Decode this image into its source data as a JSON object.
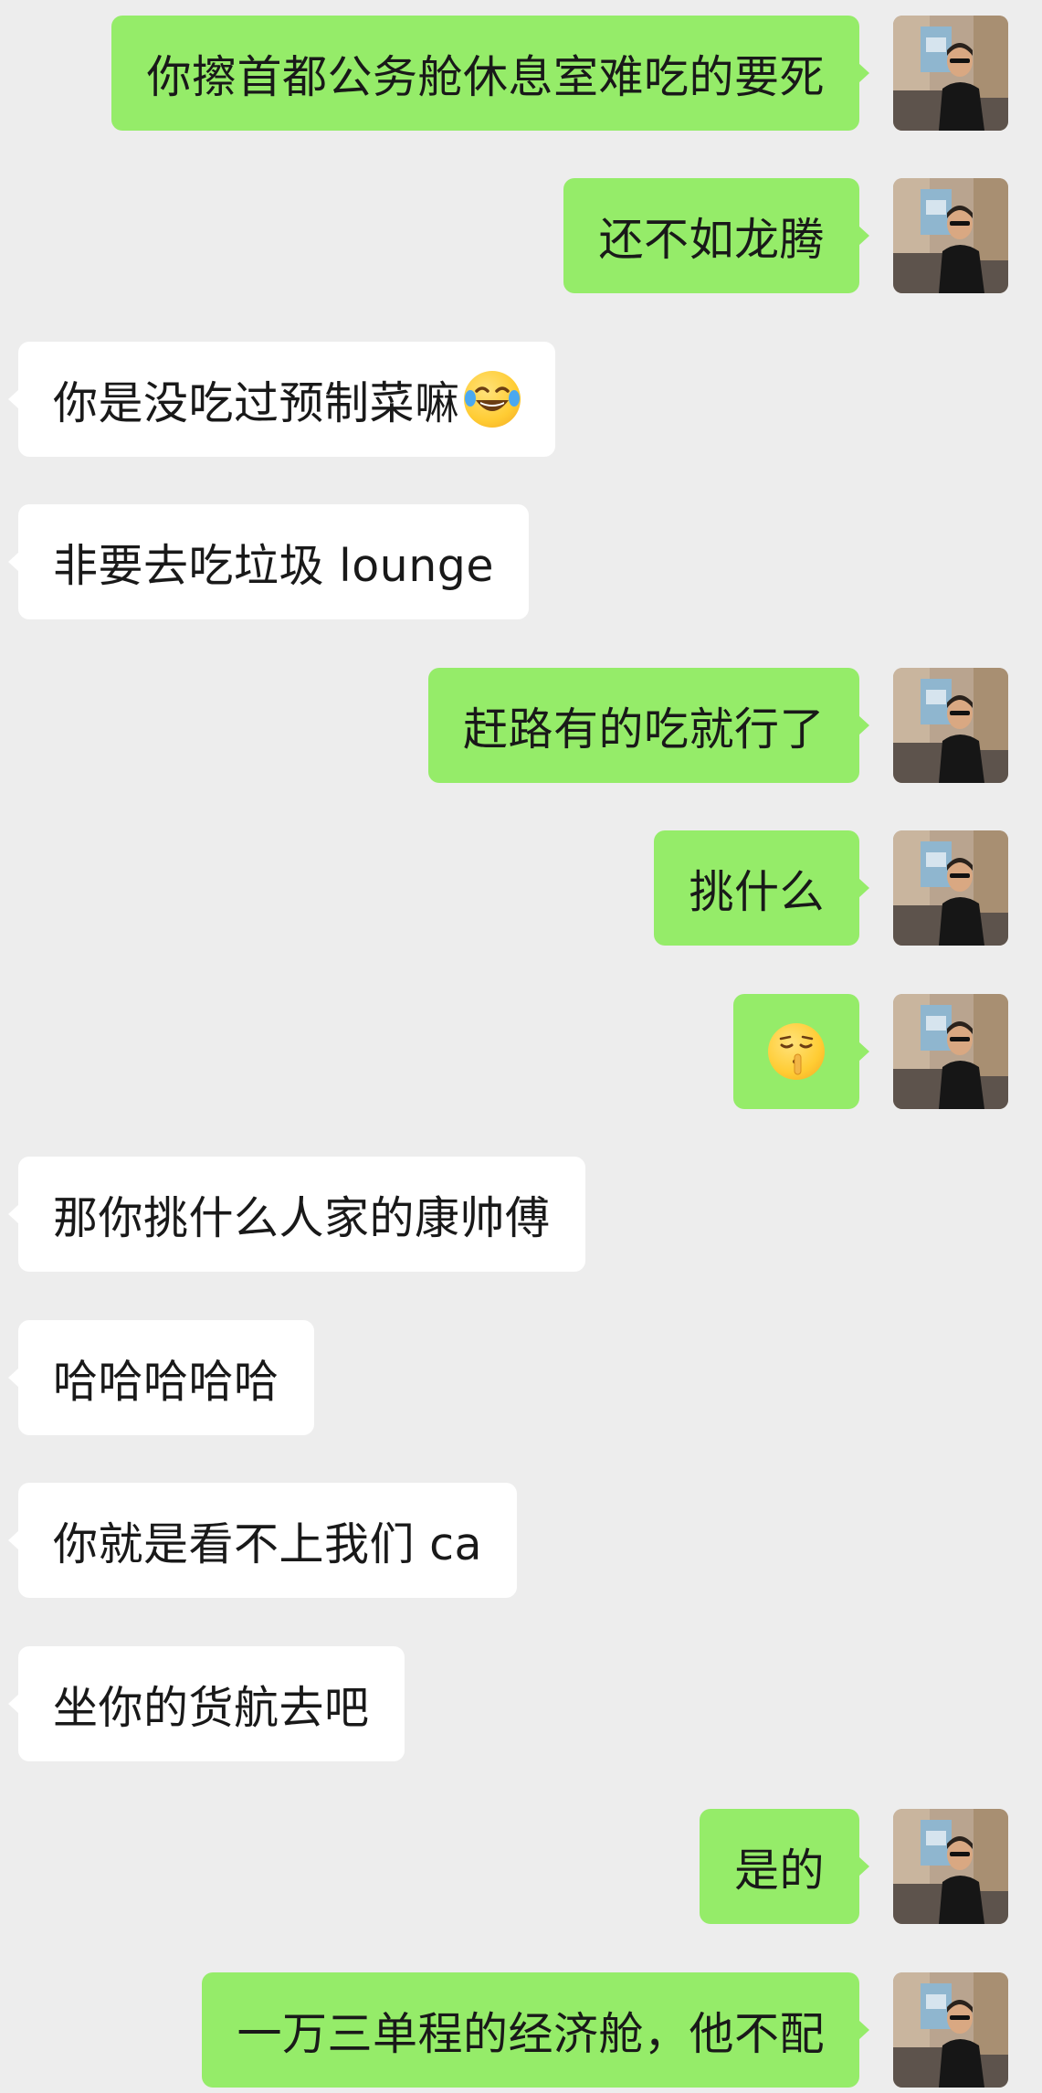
{
  "colors": {
    "background": "#ededed",
    "outgoing_bubble": "#95ec69",
    "incoming_bubble": "#ffffff",
    "text": "#191919"
  },
  "messages": [
    {
      "side": "out",
      "text": "你擦首都公务舱休息室难吃的要死"
    },
    {
      "side": "out",
      "text": "还不如龙腾"
    },
    {
      "side": "in",
      "text": "你是没吃过预制菜嘛",
      "emoji": "tears-of-joy-emoji"
    },
    {
      "side": "in",
      "text": "非要去吃垃圾 lounge"
    },
    {
      "side": "out",
      "text": "赶路有的吃就行了"
    },
    {
      "side": "out",
      "text": "挑什么"
    },
    {
      "side": "out",
      "text": "",
      "emoji": "shushing-face-emoji"
    },
    {
      "side": "in",
      "text": "那你挑什么人家的康帅傅"
    },
    {
      "side": "in",
      "text": "哈哈哈哈哈"
    },
    {
      "side": "in",
      "text": "你就是看不上我们 ca"
    },
    {
      "side": "in",
      "text": "坐你的货航去吧"
    },
    {
      "side": "out",
      "text": "是的"
    },
    {
      "side": "out",
      "text": "一万三单程的经济舱，他不配"
    }
  ]
}
